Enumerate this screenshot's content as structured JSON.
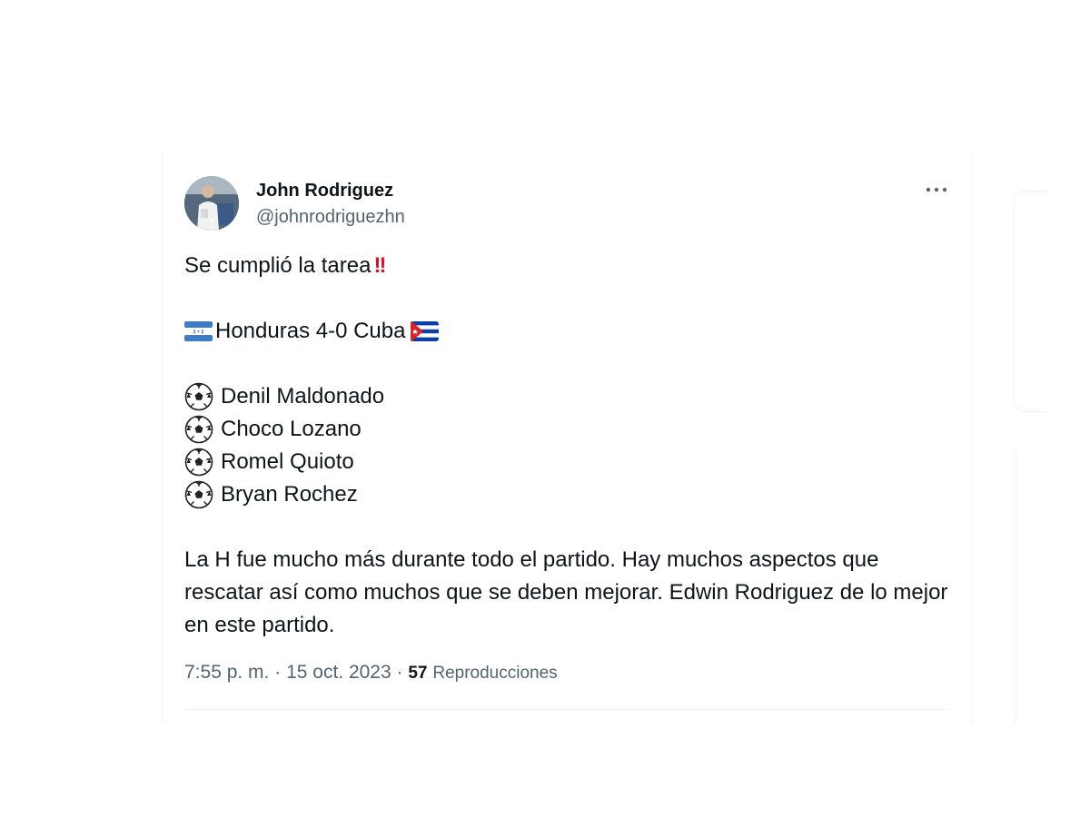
{
  "author": {
    "name": "John Rodriguez",
    "handle": "@johnrodriguezhn"
  },
  "tweet": {
    "intro": "Se cumplió la tarea",
    "score_text": "Honduras 4-0 Cuba",
    "scorers": [
      "Denil Maldonado",
      "Choco Lozano",
      "Romel Quioto",
      "Bryan Rochez"
    ],
    "paragraph": "La H fue mucho más durante todo el partido. Hay muchos aspectos que rescatar así como muchos que se deben mejorar. Edwin Rodriguez de lo mejor en este partido."
  },
  "meta": {
    "time": "7:55 p. m.",
    "separator": "·",
    "date": "15 oct. 2023",
    "views_count": "57",
    "views_label": "Reproducciones"
  },
  "icons": {
    "more": "more-horizontal-icon",
    "intro_emoji": "double-exclamation-icon",
    "honduras_flag": "honduras-flag-icon",
    "cuba_flag": "cuba-flag-icon",
    "scorer_bullet": "soccer-ball-icon"
  },
  "colors": {
    "text": "#0f1419",
    "secondary": "#536471",
    "border": "#eff3f4",
    "exclamation": "#d01b2a",
    "honduras_blue": "#3e7cc5",
    "cuba_blue": "#0b3ea8",
    "cuba_red": "#d8232a"
  }
}
